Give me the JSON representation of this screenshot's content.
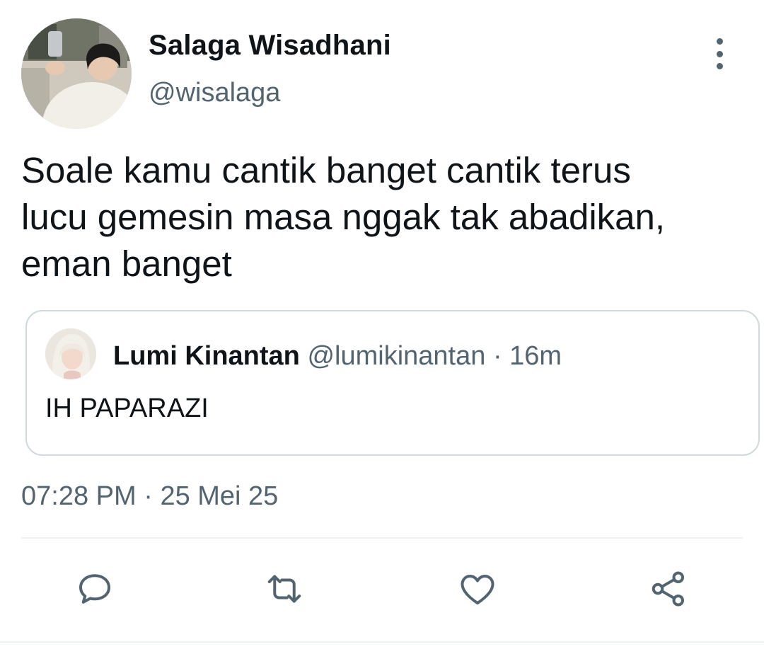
{
  "author": {
    "display_name": "Salaga Wisadhani",
    "handle": "@wisalaga",
    "avatar_icon": "profile-photo"
  },
  "tweet": {
    "text": "Soale kamu cantik banget cantik terus\nlucu gemesin masa nggak tak abadikan,\neman banget"
  },
  "quoted_tweet": {
    "display_name": "Lumi Kinantan",
    "handle": "@lumikinantan",
    "separator": "·",
    "time": "16m",
    "text": "IH PAPARAZI",
    "avatar_icon": "profile-photo"
  },
  "timestamp": {
    "time": "07:28 PM",
    "separator": "·",
    "date": "25 Mei 25"
  },
  "actions": [
    {
      "name": "reply",
      "icon": "speech-bubble-icon"
    },
    {
      "name": "retweet",
      "icon": "retweet-icon"
    },
    {
      "name": "like",
      "icon": "heart-icon"
    },
    {
      "name": "share",
      "icon": "share-icon"
    }
  ],
  "colors": {
    "primary_text": "#0f1419",
    "secondary_text": "#536471",
    "border": "#cfd9de"
  }
}
